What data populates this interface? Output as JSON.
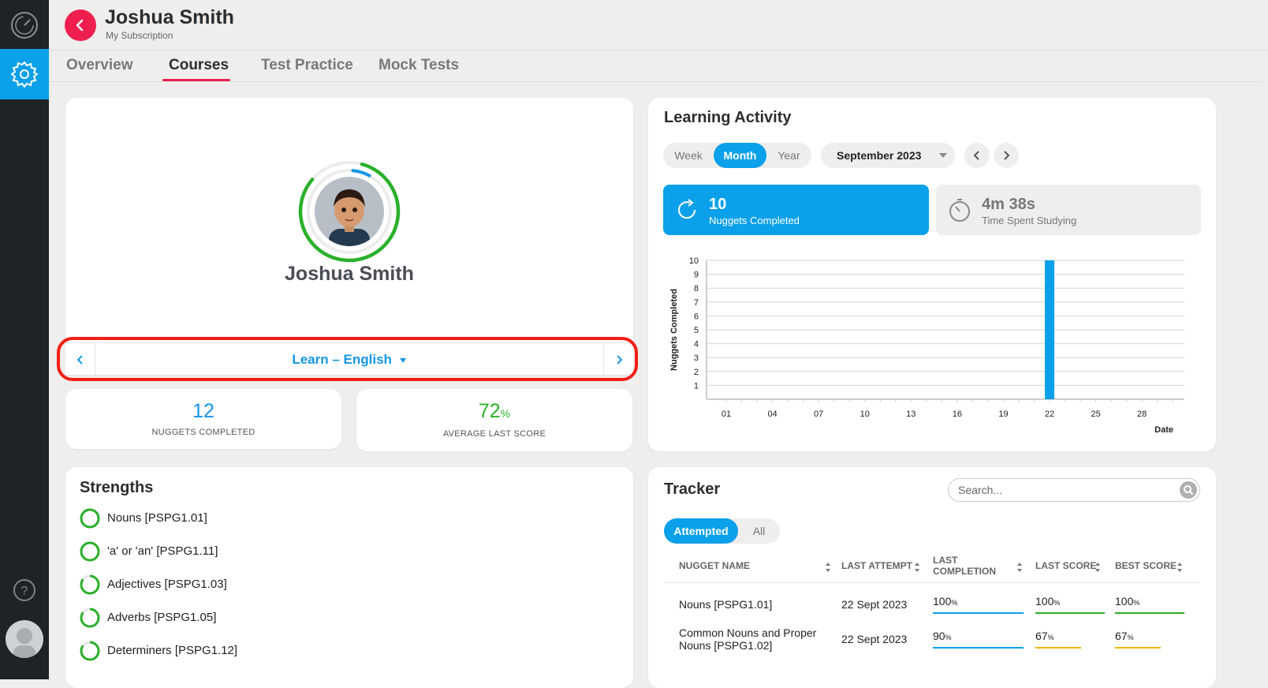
{
  "header": {
    "name": "Joshua Smith",
    "subtitle": "My Subscription"
  },
  "tabs": [
    {
      "label": "Overview"
    },
    {
      "label": "Courses"
    },
    {
      "label": "Test Practice"
    },
    {
      "label": "Mock Tests"
    }
  ],
  "profile": {
    "name": "Joshua Smith",
    "course_label": "Learn – English",
    "stats": {
      "nuggets_completed": "12",
      "nuggets_completed_label": "NUGGETS COMPLETED",
      "average_last_score": "72",
      "average_last_score_unit": "%",
      "average_last_score_label": "AVERAGE LAST SCORE"
    }
  },
  "learning_activity": {
    "title": "Learning Activity",
    "periods": [
      "Week",
      "Month",
      "Year"
    ],
    "selected_period": "Month",
    "month": "September 2023",
    "metric_nuggets": {
      "value": "10",
      "label": "Nuggets Completed"
    },
    "metric_time": {
      "value": "4m 38s",
      "label": "Time Spent Studying"
    }
  },
  "chart_data": {
    "type": "bar",
    "xlabel": "Date",
    "ylabel": "Nuggets Completed",
    "ylim": [
      0,
      10
    ],
    "yticks": [
      "1",
      "2",
      "3",
      "4",
      "5",
      "6",
      "7",
      "8",
      "9",
      "10"
    ],
    "xticks": [
      "01",
      "04",
      "07",
      "10",
      "13",
      "16",
      "19",
      "22",
      "25",
      "28"
    ],
    "categories": [
      "22"
    ],
    "values": [
      10
    ],
    "color": "#0aa0ea"
  },
  "strengths": {
    "title": "Strengths",
    "items": [
      {
        "label": "Nouns [PSPG1.01]",
        "fill": 1.0
      },
      {
        "label": "'a' or 'an' [PSPG1.11]",
        "fill": 1.0
      },
      {
        "label": "Adjectives [PSPG1.03]",
        "fill": 0.85
      },
      {
        "label": "Adverbs [PSPG1.05]",
        "fill": 0.85
      },
      {
        "label": "Determiners [PSPG1.12]",
        "fill": 0.85
      }
    ]
  },
  "tracker": {
    "title": "Tracker",
    "search_placeholder": "Search...",
    "filters": [
      "Attempted",
      "All"
    ],
    "columns": {
      "name": "NUGGET NAME",
      "last_attempt": "LAST ATTEMPT",
      "last_completion": "LAST COMPLETION",
      "last_score": "LAST SCORE",
      "best_score": "BEST SCORE"
    },
    "rows": [
      {
        "name": "Nouns [PSPG1.01]",
        "last_attempt": "22 Sept 2023",
        "last_completion": "100",
        "last_score": "100",
        "best_score": "100"
      },
      {
        "name": "Common Nouns and Proper Nouns [PSPG1.02]",
        "last_attempt": "22 Sept 2023",
        "last_completion": "90",
        "last_score": "67",
        "best_score": "67"
      }
    ]
  },
  "colors": {
    "accent": "#0aa0ea",
    "brand_red": "#ee1f4f",
    "success": "#2ab02a",
    "warning": "#f2b705",
    "highlight": "#f21e14"
  }
}
